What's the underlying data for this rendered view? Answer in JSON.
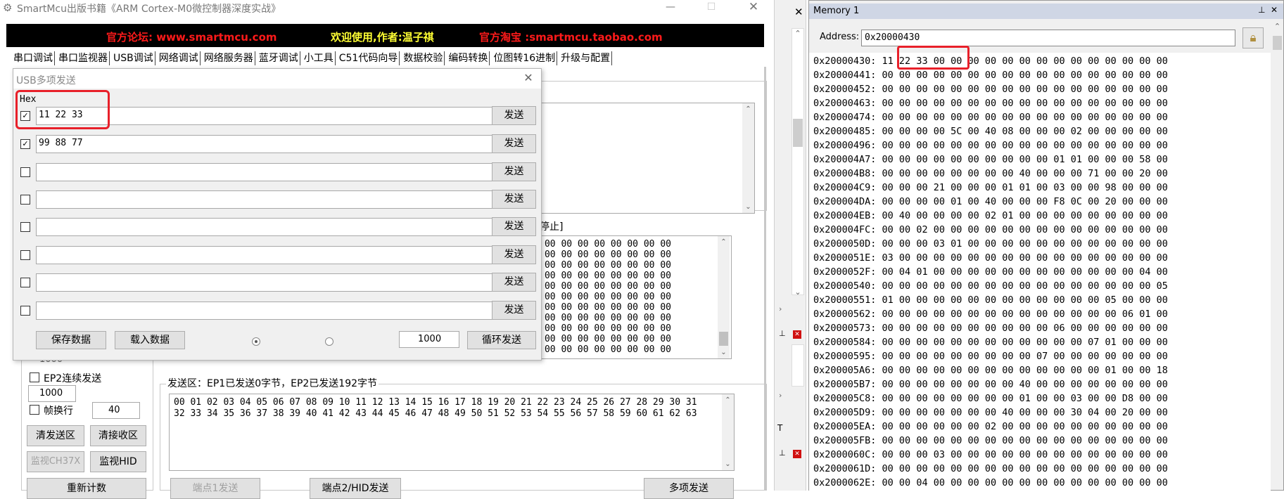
{
  "window": {
    "title": "SmartMcu出版书籍《ARM Cortex-M0微控制器深度实战》",
    "banner": {
      "forum": "官方论坛: www.smartmcu.com",
      "welcome": "欢迎使用,作者:温子祺",
      "shop": "官方淘宝 :smartmcu.taobao.com"
    },
    "controls": {
      "minimize": "—",
      "maximize": "☐",
      "close": "✕"
    }
  },
  "colors": {
    "banner_red": "#ff1a1a",
    "banner_yellow": "#ffff33",
    "highlight": "#e8202a",
    "memory_title": "#cfd6e5"
  },
  "main_tabs": [
    "串口调试",
    "串口监视器",
    "USB调试",
    "网络调试",
    "网络服务器",
    "蓝牙调试",
    "小工具",
    "C51代码向导",
    "数据校验",
    "编码转换",
    "位图转16进制",
    "升级与配置"
  ],
  "main_panel": {
    "partial_stop_label": "停止]",
    "receive_lines": [
      "00 00 00 00 00 00 00 00 00 00",
      "00 00 00 00 00 00 00 00 00 00",
      "00 00 00 00 00 00 00 00 00 00",
      "00 00 00 00 00 00 00 00 00 00",
      "00 00 00 00 00 00 00 00 00 00",
      "00 00 00 00 00 00 00 00 00 00",
      "00 00 00 00 00 00 00 00 00 00",
      "00 00 00 00 00 00 00 00 00 00",
      "00 00 00 00 00 00 00 00 00 00",
      "00 00 00 00 00 00 00 00 00 00",
      "00 00 00 00 00 00 00 00 00 00"
    ],
    "partial_1000": "1000",
    "ep2_continuous_label": "EP2连续发送",
    "interval_value": "1000",
    "frame_newline_label": "帧换行",
    "frame_value": "40",
    "clear_send_button": "清发送区",
    "clear_recv_button": "清接收区",
    "monitor_ch37x_button": "监视CH37X",
    "monitor_hid_button": "监视HID",
    "recount_button": "重新计数",
    "send_area_title": "发送区：EP1已发送0字节，EP2已发送192字节",
    "send_lines": [
      "00 01 02 03 04 05 06 07 08 09 10 11 12 13 14 15 16 17 18 19 20 21 22 23 24 25 26 27 28 29 30 31",
      "32 33 34 35 36 37 38 39 40 41 42 43 44 45 46 47 48 49 50 51 52 53 54 55 56 57 58 59 60 61 62 63"
    ],
    "ep1_send_button": "端点1发送",
    "ep2_hid_send_button": "端点2/HID发送",
    "multi_send_button": "多项发送"
  },
  "dialog": {
    "title": "USB多项发送",
    "hex_label": "Hex",
    "close": "✕",
    "rows": [
      {
        "checked": true,
        "value": "11 22 33",
        "send": "发送"
      },
      {
        "checked": true,
        "value": "99 88 77",
        "send": "发送"
      },
      {
        "checked": false,
        "value": "",
        "send": "发送"
      },
      {
        "checked": false,
        "value": "",
        "send": "发送"
      },
      {
        "checked": false,
        "value": "",
        "send": "发送"
      },
      {
        "checked": false,
        "value": "",
        "send": "发送"
      },
      {
        "checked": false,
        "value": "",
        "send": "发送"
      },
      {
        "checked": false,
        "value": "",
        "send": "发送"
      }
    ],
    "save_button": "保存数据",
    "load_button": "载入数据",
    "interval_value": "1000",
    "loop_send_button": "循环发送"
  },
  "memory": {
    "title": "Memory 1",
    "address_label": "Address:",
    "address_value": "0x20000430",
    "rows": [
      {
        "addr": "0x20000430:",
        "bytes": "11 22 33 00 00 00 00 00 00 00 00 00 00 00 00 00 00"
      },
      {
        "addr": "0x20000441:",
        "bytes": "00 00 00 00 00 00 00 00 00 00 00 00 00 00 00 00 00"
      },
      {
        "addr": "0x20000452:",
        "bytes": "00 00 00 00 00 00 00 00 00 00 00 00 00 00 00 00 00"
      },
      {
        "addr": "0x20000463:",
        "bytes": "00 00 00 00 00 00 00 00 00 00 00 00 00 00 00 00 00"
      },
      {
        "addr": "0x20000474:",
        "bytes": "00 00 00 00 00 00 00 00 00 00 00 00 00 00 00 00 00"
      },
      {
        "addr": "0x20000485:",
        "bytes": "00 00 00 00 5C 00 40 08 00 00 00 02 00 00 00 00 00"
      },
      {
        "addr": "0x20000496:",
        "bytes": "00 00 00 00 00 00 00 00 00 00 00 00 00 00 00 00 00"
      },
      {
        "addr": "0x200004A7:",
        "bytes": "00 00 00 00 00 00 00 00 00 00 01 01 00 00 00 58 00"
      },
      {
        "addr": "0x200004B8:",
        "bytes": "00 00 00 00 00 00 00 00 40 00 00 00 71 00 00 20 00"
      },
      {
        "addr": "0x200004C9:",
        "bytes": "00 00 00 21 00 00 00 01 01 00 03 00 00 98 00 00 00"
      },
      {
        "addr": "0x200004DA:",
        "bytes": "00 00 00 00 01 00 40 00 00 00 F8 0C 00 20 00 00 00"
      },
      {
        "addr": "0x200004EB:",
        "bytes": "00 40 00 00 00 00 02 01 00 00 00 00 00 00 00 00 00"
      },
      {
        "addr": "0x200004FC:",
        "bytes": "00 00 02 00 00 00 00 00 00 00 00 00 00 00 00 00 00"
      },
      {
        "addr": "0x2000050D:",
        "bytes": "00 00 00 03 01 00 00 00 00 00 00 00 00 00 00 00 00"
      },
      {
        "addr": "0x2000051E:",
        "bytes": "03 00 00 00 00 00 00 00 00 00 00 00 00 00 00 00 00"
      },
      {
        "addr": "0x2000052F:",
        "bytes": "00 04 01 00 00 00 00 00 00 00 00 00 00 00 00 04 00"
      },
      {
        "addr": "0x20000540:",
        "bytes": "00 00 00 00 00 00 00 00 00 00 00 00 00 00 00 00 05"
      },
      {
        "addr": "0x20000551:",
        "bytes": "01 00 00 00 00 00 00 00 00 00 00 00 00 05 00 00 00"
      },
      {
        "addr": "0x20000562:",
        "bytes": "00 00 00 00 00 00 00 00 00 00 00 00 00 00 06 01 00"
      },
      {
        "addr": "0x20000573:",
        "bytes": "00 00 00 00 00 00 00 00 00 00 06 00 00 00 00 00 00"
      },
      {
        "addr": "0x20000584:",
        "bytes": "00 00 00 00 00 00 00 00 00 00 00 00 07 01 00 00 00"
      },
      {
        "addr": "0x20000595:",
        "bytes": "00 00 00 00 00 00 00 00 00 07 00 00 00 00 00 00 00"
      },
      {
        "addr": "0x200005A6:",
        "bytes": "00 00 00 00 00 00 00 00 00 00 00 00 00 01 00 00 18"
      },
      {
        "addr": "0x200005B7:",
        "bytes": "00 00 00 00 00 00 00 00 40 00 00 00 00 00 00 00 00"
      },
      {
        "addr": "0x200005C8:",
        "bytes": "00 00 00 00 00 00 00 00 01 00 00 03 00 00 D8 00 00"
      },
      {
        "addr": "0x200005D9:",
        "bytes": "00 00 00 00 00 00 00 40 00 00 00 30 04 00 20 00 00"
      },
      {
        "addr": "0x200005EA:",
        "bytes": "00 00 00 00 00 00 02 00 00 00 00 00 00 00 00 00 00"
      },
      {
        "addr": "0x200005FB:",
        "bytes": "00 00 00 00 00 00 00 00 00 00 00 00 00 00 00 00 00"
      },
      {
        "addr": "0x2000060C:",
        "bytes": "00 00 00 03 00 00 00 00 00 00 00 00 00 00 00 00 00"
      },
      {
        "addr": "0x2000061D:",
        "bytes": "00 00 00 00 00 00 00 00 00 00 00 00 00 00 00 00 00"
      },
      {
        "addr": "0x2000062E:",
        "bytes": "00 00 04 00 00 00 00 00 00 00 00 00 00 00 00 00 00"
      }
    ]
  },
  "side_strip": {
    "close_label": "✕",
    "pin_label": "⊥",
    "partial_t": "T",
    "red_x": "✕"
  }
}
